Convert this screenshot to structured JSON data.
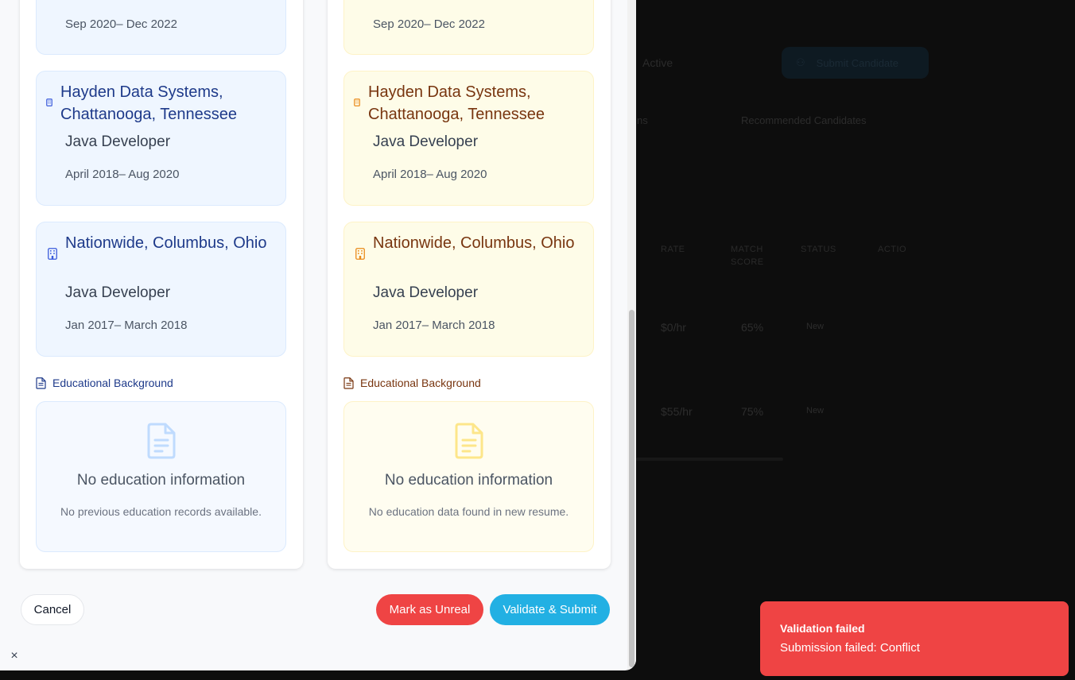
{
  "background": {
    "status_value": "Active",
    "submit_candidate_label": "Submit Candidate",
    "tab_partial": "ns",
    "tab_recommended": "Recommended Candidates",
    "headers": [
      "RATE",
      "MATCH SCORE",
      "STATUS",
      "ACTIO"
    ],
    "rows": [
      {
        "rate": "$0/hr",
        "match": "65%",
        "status": "New"
      },
      {
        "rate": "$55/hr",
        "match": "75%",
        "status": "New"
      }
    ]
  },
  "left_panel": {
    "experiences": [
      {
        "date": "Sep 2020– Dec 2022"
      },
      {
        "company": "Hayden Data Systems, Chattanooga, Tennessee",
        "role": "Java Developer",
        "date": "April 2018– Aug 2020"
      },
      {
        "company": "Nationwide, Columbus, Ohio",
        "role": "Java Developer",
        "date": "Jan 2017– March 2018"
      }
    ],
    "education_label": "Educational Background",
    "empty_title": "No education information",
    "empty_sub": "No previous education records available."
  },
  "right_panel": {
    "experiences": [
      {
        "date": "Sep 2020– Dec 2022"
      },
      {
        "company": "Hayden Data Systems, Chattanooga, Tennessee",
        "role": "Java Developer",
        "date": "April 2018– Aug 2020"
      },
      {
        "company": "Nationwide, Columbus, Ohio",
        "role": "Java Developer",
        "date": "Jan 2017– March 2018"
      }
    ],
    "education_label": "Educational Background",
    "empty_title": "No education information",
    "empty_sub": "No education data found in new resume."
  },
  "actions": {
    "cancel": "Cancel",
    "mark_unreal": "Mark as Unreal",
    "validate_submit": "Validate & Submit",
    "close": "×"
  },
  "toast": {
    "title": "Validation failed",
    "description": "Submission failed: Conflict"
  },
  "colors": {
    "danger": "#ef4444",
    "primary": "#22b0e3",
    "old_accent": "#1e3a8a",
    "new_accent": "#78350f"
  }
}
